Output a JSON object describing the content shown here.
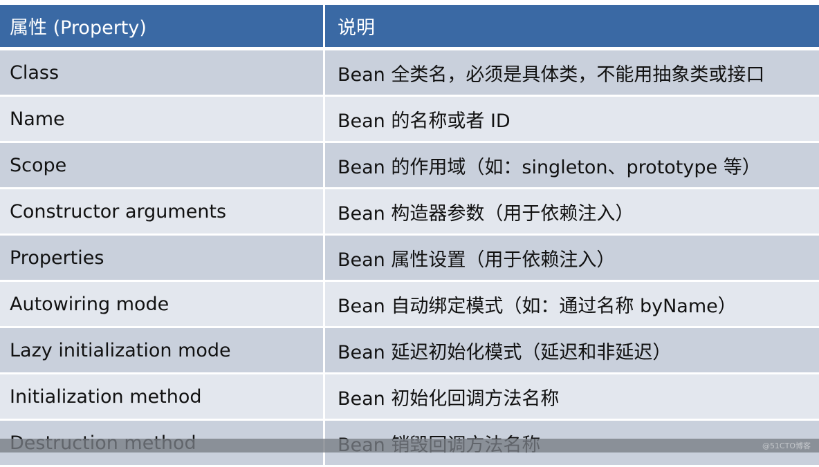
{
  "header": {
    "col1": "属性 (Property)",
    "col2": "说明"
  },
  "rows": [
    {
      "property": "Class",
      "description": "Bean 全类名，必须是具体类，不能用抽象类或接口"
    },
    {
      "property": "Name",
      "description": "Bean 的名称或者 ID"
    },
    {
      "property": "Scope",
      "description": "Bean 的作用域（如：singleton、prototype 等）"
    },
    {
      "property": "Constructor arguments",
      "description": "Bean 构造器参数（用于依赖注入）"
    },
    {
      "property": "Properties",
      "description": "Bean 属性设置（用于依赖注入）"
    },
    {
      "property": "Autowiring mode",
      "description": "Bean 自动绑定模式（如：通过名称 byName）"
    },
    {
      "property": "Lazy initialization mode",
      "description": "Bean 延迟初始化模式（延迟和非延迟）"
    },
    {
      "property": "Initialization method",
      "description": "Bean 初始化回调方法名称"
    },
    {
      "property": "Destruction method",
      "description": "Bean 销毁回调方法名称"
    }
  ],
  "watermark": "@51CTO博客",
  "colors": {
    "header": "#3a69a4",
    "row_dark": "#c9d0dc",
    "row_light": "#e3e7ee"
  }
}
